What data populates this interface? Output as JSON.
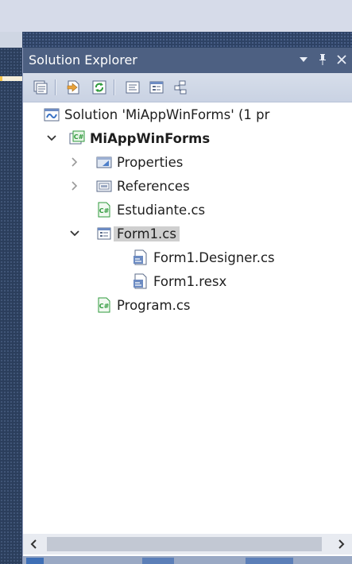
{
  "panel": {
    "title": "Solution Explorer",
    "title_buttons": [
      "dropdown-icon",
      "pin-icon",
      "close-icon"
    ]
  },
  "toolbar": {
    "buttons": [
      "properties-icon",
      "show-all-files-icon",
      "refresh-icon",
      "view-code-icon",
      "view-designer-icon",
      "class-diagram-icon"
    ]
  },
  "tree": {
    "solution": "Solution 'MiAppWinForms' (1 pr",
    "project": "MiAppWinForms",
    "properties": "Properties",
    "references": "References",
    "estudiante": "Estudiante.cs",
    "form1": "Form1.cs",
    "form1_designer": "Form1.Designer.cs",
    "form1_resx": "Form1.resx",
    "program": "Program.cs"
  },
  "colors": {
    "title_bar": "#4d6082",
    "toolbar": "#cfd7e6",
    "selection": "#cfcfcf",
    "csharp_green": "#2f9a3c"
  }
}
